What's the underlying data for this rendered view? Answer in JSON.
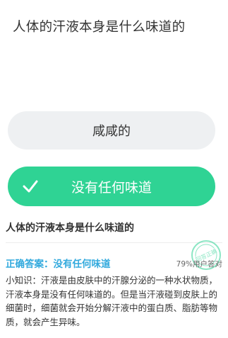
{
  "question": {
    "title": "人体的汗液本身是什么味道的"
  },
  "options": [
    {
      "label": "咸咸的",
      "selected": false
    },
    {
      "label": "没有任何味道",
      "selected": true,
      "icon": "check-icon"
    }
  ],
  "explanation": {
    "title": "人体的汗液本身是什么味道的",
    "answer_text": "正确答案：没有任何味道",
    "percent_text": "79%用户答对",
    "stamp_text": "回答正确",
    "tip_text": "小知识：汗液是由皮肤中的汗腺分泌的一种水状物质，汗液本身是没有任何味道的。但是当汗液碰到皮肤上的细菌时，细菌就会开始分解汗液中的蛋白质、脂肪等物质，就会产生异味。"
  },
  "colors": {
    "correct_green": "#2fd394",
    "answer_blue": "#31a9dd",
    "option_gray": "#eef0f2"
  }
}
